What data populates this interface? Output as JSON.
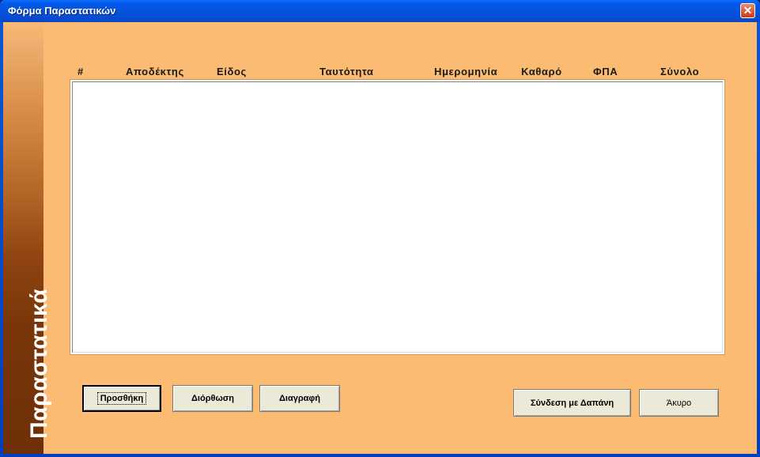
{
  "window": {
    "title": "Φόρμα Παραστατικών",
    "close_glyph": "✕"
  },
  "sidebar": {
    "label": "Παραστατικά"
  },
  "table": {
    "columns": [
      "#",
      "Αποδέκτης",
      "Είδος",
      "Ταυτότητα",
      "Ημερομηνία",
      "Καθαρό",
      "ΦΠΑ",
      "Σύνολο"
    ],
    "rows": []
  },
  "buttons": {
    "add": "Προσθήκη",
    "edit": "Διόρθωση",
    "delete": "Διαγραφή",
    "link_expense": "Σύνδεση με Δαπάνη",
    "cancel": "Άκυρο"
  },
  "colors": {
    "form_background": "#fbbb72",
    "banner_dark": "#6e3008",
    "titlebar": "#0457e6"
  }
}
